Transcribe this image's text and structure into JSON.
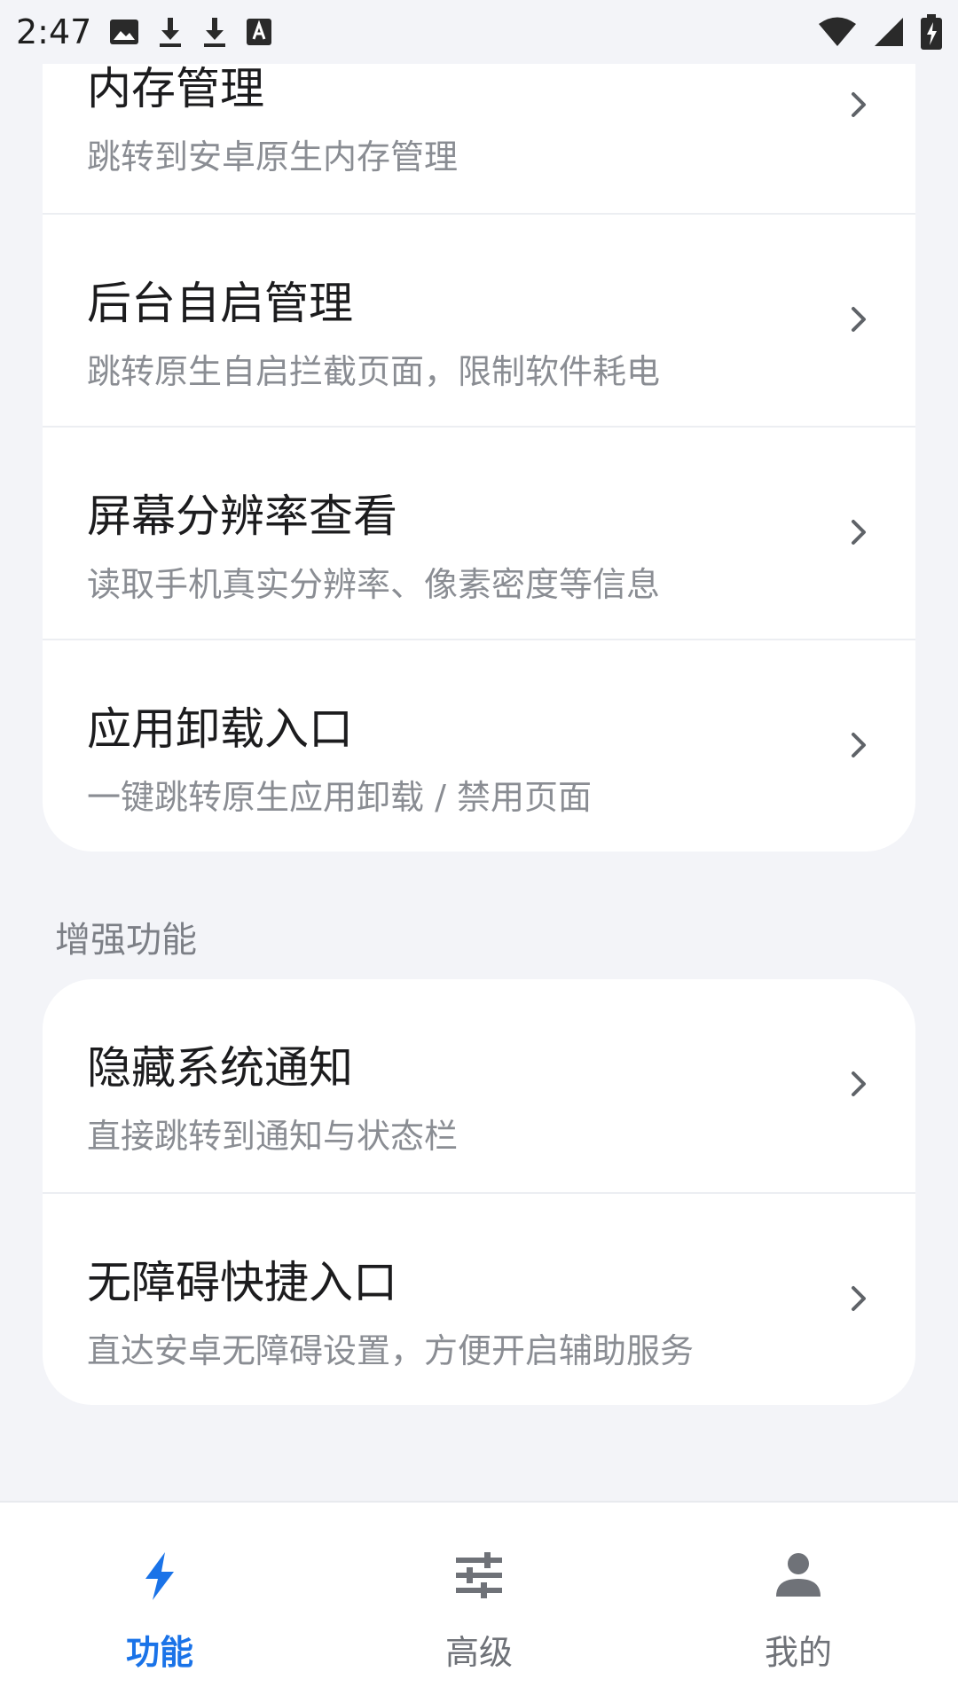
{
  "status_bar": {
    "time": "2:47",
    "left_icons": [
      "image-icon",
      "download-icon",
      "download-icon",
      "font-icon"
    ],
    "right_icons": [
      "wifi-icon",
      "signal-icon",
      "battery-charging-icon"
    ]
  },
  "cards": [
    {
      "items": [
        {
          "title": "内存管理",
          "subtitle": "跳转到安卓原生内存管理"
        },
        {
          "title": "后台自启管理",
          "subtitle": "跳转原生自启拦截页面，限制软件耗电"
        },
        {
          "title": "屏幕分辨率查看",
          "subtitle": "读取手机真实分辨率、像素密度等信息"
        },
        {
          "title": "应用卸载入口",
          "subtitle": "一键跳转原生应用卸载 / 禁用页面"
        }
      ]
    }
  ],
  "section": {
    "title": "增强功能",
    "items": [
      {
        "title": "隐藏系统通知",
        "subtitle": "直接跳转到通知与状态栏"
      },
      {
        "title": "无障碍快捷入口",
        "subtitle": "直达安卓无障碍设置，方便开启辅助服务"
      }
    ]
  },
  "bottom_nav": {
    "items": [
      {
        "label": "功能",
        "icon": "bolt-icon",
        "active": true
      },
      {
        "label": "高级",
        "icon": "sliders-icon",
        "active": false
      },
      {
        "label": "我的",
        "icon": "person-icon",
        "active": false
      }
    ]
  },
  "colors": {
    "accent": "#1a73e8",
    "background": "#f3f4f8",
    "card": "#ffffff",
    "subtitle": "#8a8d93"
  }
}
